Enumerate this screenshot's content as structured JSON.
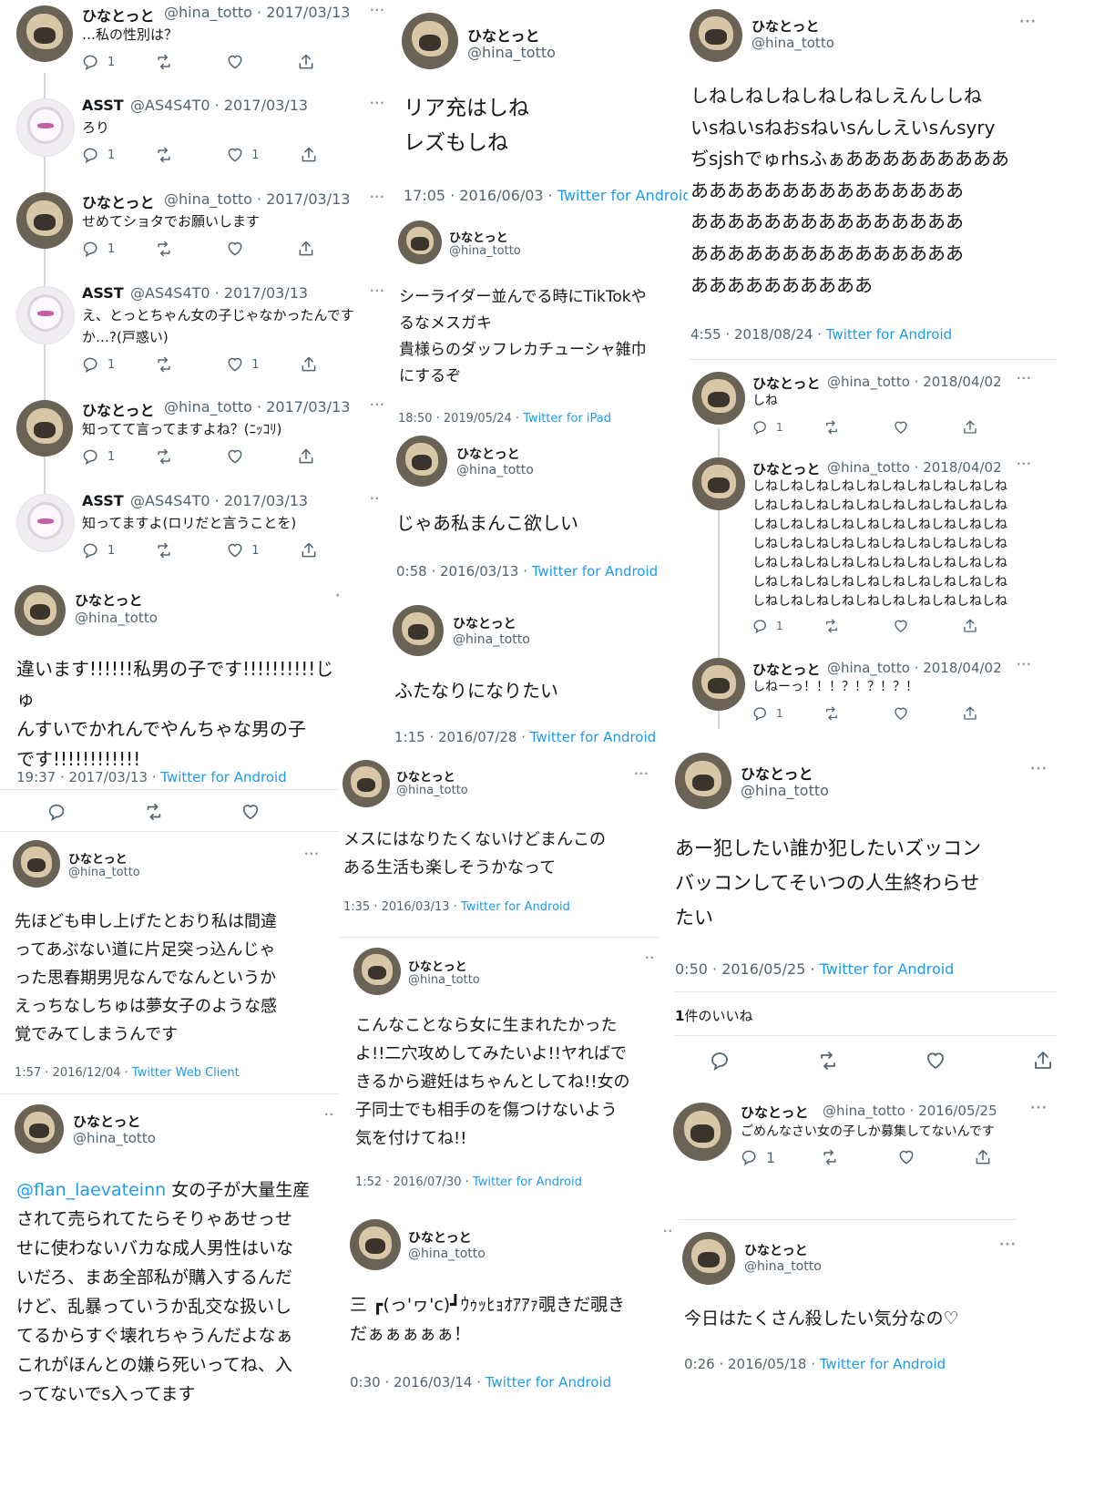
{
  "user_hina": {
    "name": "ひなとっと",
    "handle": "@hina_totto"
  },
  "user_asst": {
    "name": "ASST",
    "handle": "@AS4S4T0"
  },
  "icons": [
    "reply-icon",
    "retweet-icon",
    "like-icon",
    "share-icon",
    "more-icon",
    "avatar"
  ],
  "colors": {
    "link": "#1d9bf0",
    "muted": "#536471",
    "text": "#14171a",
    "divider": "#e1e8ed"
  },
  "thread1": [
    {
      "name": "ひなとっと",
      "handle": "@hina_totto",
      "date": "· 2017/03/13",
      "text": "…私の性別は？",
      "replies": "1",
      "likes": ""
    },
    {
      "name": "ASST",
      "handle": "@AS4S4T0",
      "date": "· 2017/03/13",
      "text": "ろり",
      "replies": "1",
      "likes": "1"
    },
    {
      "name": "ひなとっと",
      "handle": "@hina_totto",
      "date": "· 2017/03/13",
      "text": "せめてショタでお願いします",
      "replies": "1",
      "likes": ""
    },
    {
      "name": "ASST",
      "handle": "@AS4S4T0",
      "date": "· 2017/03/13",
      "text": "え、とっとちゃん女の子じゃなかったんです\nか…?(戸惑い)",
      "replies": "1",
      "likes": "1"
    },
    {
      "name": "ひなとっと",
      "handle": "@hina_totto",
      "date": "· 2017/03/13",
      "text": "知ってて言ってますよね？(ﾆｯｺﾘ)",
      "replies": "1",
      "likes": ""
    },
    {
      "name": "ASST",
      "handle": "@AS4S4T0",
      "date": "· 2017/03/13",
      "text": "知ってますよ(ロリだと言うことを)",
      "replies": "1",
      "likes": "1"
    }
  ],
  "t_boy": {
    "text": "違います!!!!!!私男の子です!!!!!!!!!!じゅ\nんすいでかれんでやんちゃな男の子\nです!!!!!!!!!!!!",
    "time": "19:37 · 2017/03/13 · ",
    "source": "Twitter for Android"
  },
  "t_senpai": {
    "text": "先ほども申し上げたとおり私は間違\nってあぶない道に片足突っ込んじゃ\nった思春期男児なんでなんというか\nえっちなしちゅは夢女子のような感\n覚でみてしまうんです",
    "time": "1:57 · 2016/12/04 · ",
    "source": "Twitter Web Client"
  },
  "t_flan": {
    "mention": "@flan_laevateinn",
    "text": " 女の子が大量生産\nされて売られてたらそりゃあせっせ\nせに使わないバカな成人男性はいな\nいだろ、まあ全部私が購入するんだ\nけど、乱暴っていうか乱交な扱いし\nてるからすぐ壊れちゃうんだよなぁ\nこれがほんとの嫌ら死いってね、入\nってないでs入ってます"
  },
  "t_riajuu": {
    "text": "リア充はしね\nレズもしね",
    "time": "17:05 · 2016/06/03 · ",
    "source": "Twitter for Android"
  },
  "t_seaider": {
    "text": "シーライダー並んでる時にTikTokや\nるなメスガキ\n貴様らのダッフレカチューシャ雑巾\nにするぞ",
    "time": "18:50 · 2019/05/24 · ",
    "source": "Twitter for iPad"
  },
  "t_jaa": {
    "text": "じゃあ私まんこ欲しい",
    "time": "0:58 · 2016/03/13 · ",
    "source": "Twitter for Android"
  },
  "t_futanari": {
    "text": "ふたなりになりたい",
    "time": "1:15 · 2016/07/28 · ",
    "source": "Twitter for Android"
  },
  "t_mesu": {
    "text": "メスにはなりたくないけどまんこの\nある生活も楽しそうかなって",
    "time": "1:35 · 2016/03/13 · ",
    "source": "Twitter for Android"
  },
  "t_konna": {
    "text": "こんなことなら女に生まれたかった\nよ!!二穴攻めしてみたいよ!!ヤればで\nきるから避妊はちゃんとしてね!!女の\n子同士でも相手のを傷つけないよう\n気を付けてね!!",
    "time": "1:52 · 2016/07/30 · ",
    "source": "Twitter for Android"
  },
  "t_mitsu": {
    "text": "三 ┏(っ'ヮ'c)┛ｳｩｯﾋｮｵｱｱｧ覗きだ覗き\nだぁぁぁぁぁ！",
    "time": "0:30 · 2016/03/14 · ",
    "source": "Twitter for Android"
  },
  "t_shine": {
    "text": "しねしねしねしねしねしえんししね\nいsねいsねおsねいsんしえいsんsyry\nぢsjshでゅrhsふぁあああああああああ\nあああああああああああああああ\nあああああああああああああああ\nあああああああああああああああ\nああああああああああ",
    "time": "4:55 · 2018/08/24 · ",
    "source": "Twitter for Android"
  },
  "thread2": [
    {
      "date": "· 2018/04/02",
      "text": "しね",
      "replies": "1"
    },
    {
      "date": "· 2018/04/02",
      "text": "しねしねしねしねしねしねしねしねしねしね\nしねしねしねしねしねしねしねしねしねしね\nしねしねしねしねしねしねしねしねしねしね\nしねしねしねしねしねしねしねしねしねしね\nしねしねしねしねしねしねしねしねしねしね\nしねしねしねしねしねしねしねしねしねしね\nしねしねしねしねしねしねしねしねしねしね",
      "replies": "1"
    },
    {
      "date": "· 2018/04/02",
      "text": "しねーっ！！！？！？！？！",
      "replies": "1"
    }
  ],
  "t_okashi": {
    "text": "あー犯したい誰か犯したいズッコン\nバッコンしてそいつの人生終わらせ\nたい",
    "time": "0:50 · 2016/05/25 · ",
    "source": "Twitter for Android",
    "likes_count": "1",
    "likes_label": "件のいいね"
  },
  "t_gomen": {
    "date": "· 2016/05/25",
    "text": "ごめんなさい女の子しか募集してないんです",
    "replies": "1"
  },
  "t_kyou": {
    "text": "今日はたくさん殺したい気分なの♡",
    "time": "0:26 · 2016/05/18 · ",
    "source": "Twitter for Android"
  }
}
